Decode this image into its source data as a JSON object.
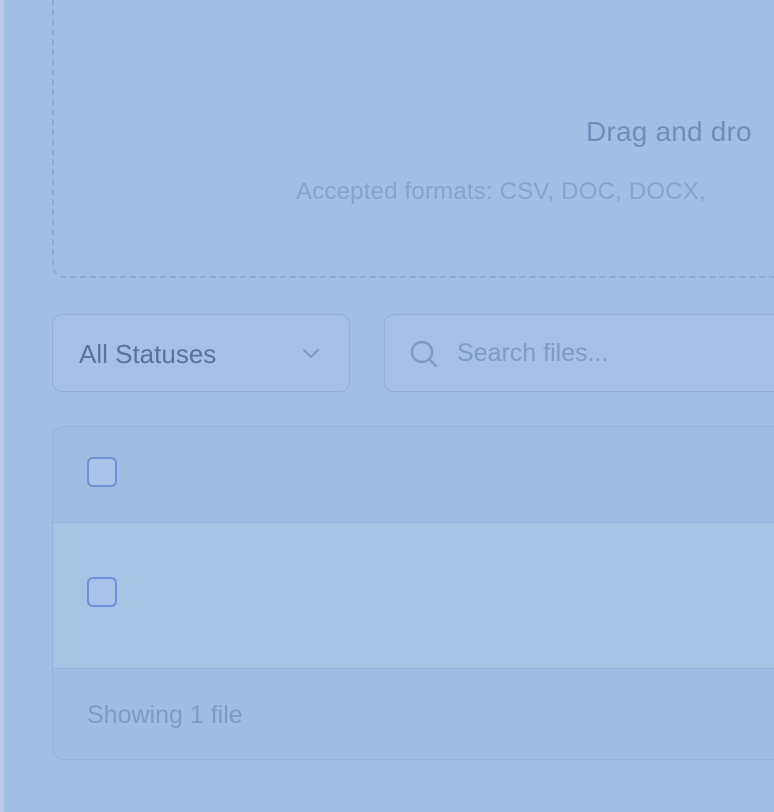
{
  "upload": {
    "title": "Drag and dro",
    "formats": "Accepted formats: CSV, DOC, DOCX,"
  },
  "filters": {
    "status": {
      "selected": "All Statuses",
      "icon": "chevron-down-icon"
    },
    "search": {
      "placeholder": "Search files...",
      "value": "",
      "icon": "search-icon"
    }
  },
  "table": {
    "header_checkbox_checked": false,
    "rows": [
      {
        "checked": false
      }
    ],
    "footer": "Showing 1 file"
  },
  "colors": {
    "background": "#a2bfe4",
    "checkbox_border": "#6e90d8",
    "text": "#58739b"
  }
}
